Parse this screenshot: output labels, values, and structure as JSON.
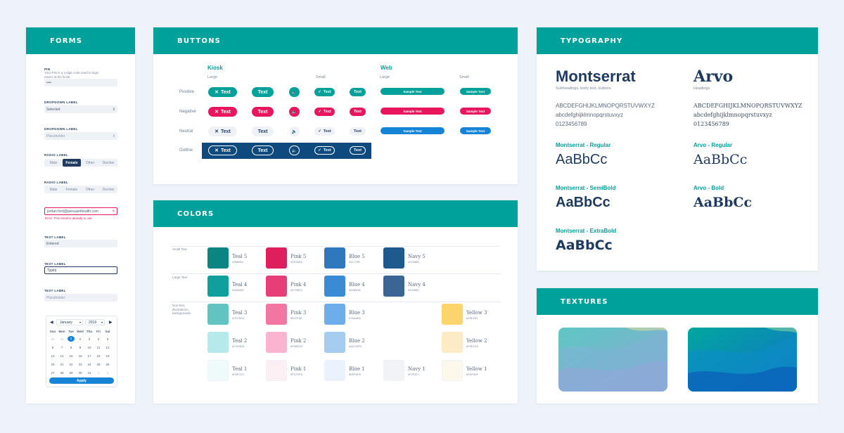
{
  "forms": {
    "title": "FORMS",
    "pin_label": "PIN",
    "pin_help": "Your PIN is a 4-digit code used to login easier at the kiosk.",
    "pin_value": "••••",
    "dropdown1_label": "DROPDOWN LABEL",
    "dropdown1_value": "Selected",
    "dropdown2_label": "DROPDOWN LABEL",
    "dropdown2_value": "Placeholder",
    "radio1_label": "RADIO LABEL",
    "radio1_options": [
      "Male",
      "Female",
      "Other",
      "Decline"
    ],
    "radio1_selected": "Female",
    "radio2_label": "RADIO LABEL",
    "radio2_options": [
      "Male",
      "Female",
      "Other",
      "Decline"
    ],
    "email_value": "jordan.ford@pursuanthealth.com",
    "email_error": "Error: This email is already is use.",
    "text1_label": "TEXT LABEL",
    "text1_value": "Entered",
    "text2_label": "TEXT LABEL",
    "text2_value": "Typin|",
    "text3_label": "TEXT LABEL",
    "text3_value": "Placeholder",
    "calendar": {
      "month": "January",
      "year": "2019",
      "weekdays": [
        "Sun",
        "Mon",
        "Tue",
        "Wed",
        "Thu",
        "Fri",
        "Sat"
      ],
      "weeks": [
        [
          "30",
          "31",
          "1",
          "2",
          "3",
          "4",
          "5"
        ],
        [
          "6",
          "7",
          "8",
          "9",
          "10",
          "11",
          "12"
        ],
        [
          "13",
          "14",
          "15",
          "16",
          "17",
          "18",
          "19"
        ],
        [
          "20",
          "21",
          "22",
          "23",
          "24",
          "25",
          "26"
        ],
        [
          "27",
          "28",
          "29",
          "30",
          "31",
          "1",
          "2"
        ]
      ],
      "selected_day": "1",
      "apply_label": "Apply"
    }
  },
  "buttons": {
    "title": "BUTTONS",
    "kiosk_label": "Kiosk",
    "web_label": "Web",
    "large_label": "Large",
    "small_label": "Small",
    "rows": [
      "Positive",
      "Negative",
      "Neutral",
      "Outline"
    ],
    "text_label": "Text",
    "sample_text": "Sample Text"
  },
  "colors": {
    "title": "COLORS",
    "group_small": "Small Text",
    "group_large": "Large Text",
    "group_non": "Non-text, illustrations, backgrounds",
    "swatches": [
      {
        "name": "Teal 5",
        "hex": "#388084",
        "color": "#0a8581"
      },
      {
        "name": "Pink 5",
        "hex": "#CF345A",
        "color": "#df1e5d"
      },
      {
        "name": "Blue 5",
        "hex": "#41719E",
        "color": "#2f78bd"
      },
      {
        "name": "Navy 5",
        "hex": "#21588D",
        "color": "#1e5a8e"
      },
      {
        "name": "Teal 4",
        "hex": "#4A9A95",
        "color": "#10a09b"
      },
      {
        "name": "Pink 4",
        "hex": "#D74B70",
        "color": "#e83e77"
      },
      {
        "name": "Blue 4",
        "hex": "#4983CB",
        "color": "#3b8ad6"
      },
      {
        "name": "Navy 4",
        "hex": "#42658C",
        "color": "#3b6594"
      },
      {
        "name": "Teal 3",
        "hex": "#7FC5C5",
        "color": "#62c4c1"
      },
      {
        "name": "Pink 3",
        "hex": "#E47F9E",
        "color": "#f276a1"
      },
      {
        "name": "Blue 3",
        "hex": "#76AAE6",
        "color": "#6daeea"
      },
      {
        "name": "Yellow 3",
        "hex": "#F8D781",
        "color": "#fbd46b"
      },
      {
        "name": "Teal 2",
        "hex": "#C1E5E8",
        "color": "#b6e9ea"
      },
      {
        "name": "Pink 2",
        "hex": "#F5BDCF",
        "color": "#fbb4cf"
      },
      {
        "name": "Blue 2",
        "hex": "#ACCDF0",
        "color": "#a6ccf0"
      },
      {
        "name": "Yellow 2",
        "hex": "#F9E2C6",
        "color": "#fdebc6"
      },
      {
        "name": "Teal 1",
        "hex": "#F5FCFC",
        "color": "#effafa"
      },
      {
        "name": "Pink 1",
        "hex": "#FCF2F6",
        "color": "#fdf0f4"
      },
      {
        "name": "Blue 1",
        "hex": "#EEF6FE",
        "color": "#eaf3fd"
      },
      {
        "name": "Navy 1",
        "hex": "#F2F4F7",
        "color": "#f1f3f6"
      },
      {
        "name": "Yellow 1",
        "hex": "#FDF9EF",
        "color": "#fdf8ec"
      }
    ]
  },
  "typography": {
    "title": "TYPOGRAPHY",
    "font1_name": "Montserrat",
    "font1_usage": "Subheadings, body text, buttons",
    "font2_name": "Arvo",
    "font2_usage": "Headings",
    "uppercase": "ABCDEFGHIJKLMNOPQRSTUVWXYZ",
    "lowercase": "abcdefghijklmnopqrstuvxyz",
    "digits": "0123456789",
    "m_regular": "Montserrat - Regular",
    "m_semibold": "Montserrat - SemiBold",
    "m_extrabold": "Montserrat - ExtraBold",
    "a_regular": "Arvo - Regular",
    "a_bold": "Arvo - Bold",
    "sample": "AaBbCc"
  },
  "textures": {
    "title": "TEXTURES"
  },
  "colors_theme": {
    "teal": "#00a19a",
    "pink": "#e8175d",
    "navy": "#0e4a7e",
    "blue": "#1584d6"
  }
}
